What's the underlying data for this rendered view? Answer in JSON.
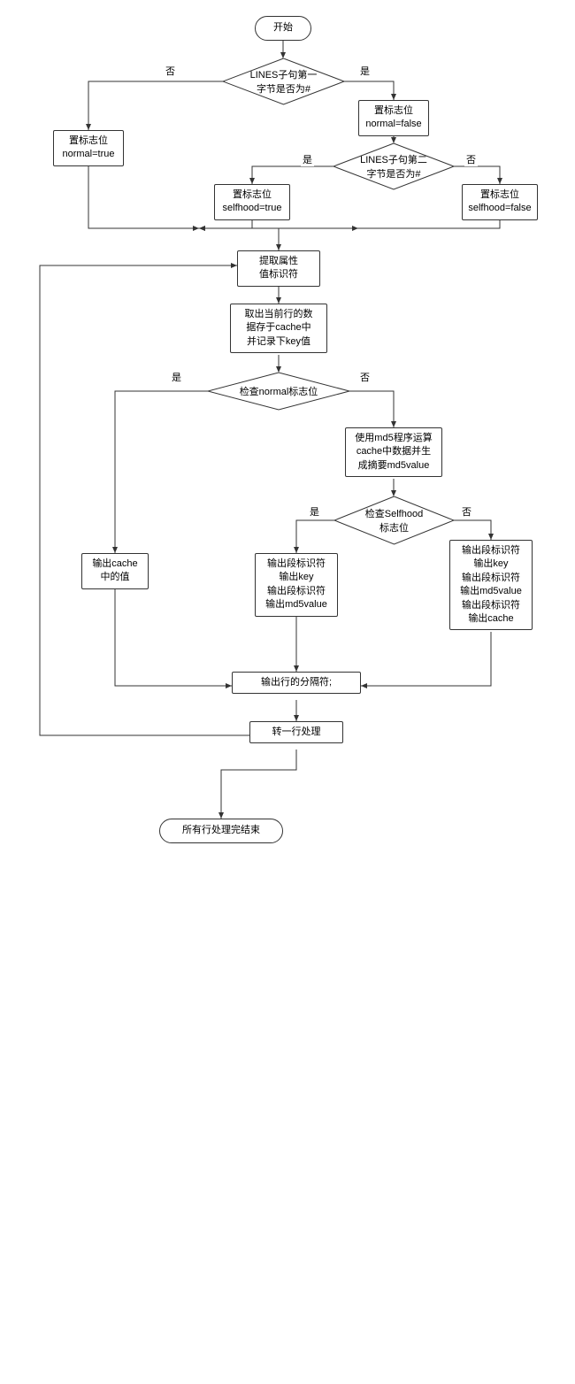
{
  "chart_data": {
    "type": "flowchart",
    "nodes": [
      {
        "id": "start",
        "type": "terminator",
        "text": "开始"
      },
      {
        "id": "d1",
        "type": "decision",
        "text": "LINES子句第一字节是否为#"
      },
      {
        "id": "p_normal_true",
        "type": "process",
        "text": "置标志位\nnormal=true"
      },
      {
        "id": "p_normal_false",
        "type": "process",
        "text": "置标志位\nnormal=false"
      },
      {
        "id": "d2",
        "type": "decision",
        "text": "LINES子句第二字节是否为#"
      },
      {
        "id": "p_self_true",
        "type": "process",
        "text": "置标志位\nselfhood=true"
      },
      {
        "id": "p_self_false",
        "type": "process",
        "text": "置标志位\nselfhood=false"
      },
      {
        "id": "p_extract",
        "type": "process",
        "text": "提取属性\n值标识符"
      },
      {
        "id": "p_cache",
        "type": "process",
        "text": "取出当前行的数\n据存于cache中\n并记录下key值"
      },
      {
        "id": "d3",
        "type": "decision",
        "text": "检查normal标志位"
      },
      {
        "id": "p_md5",
        "type": "process",
        "text": "使用md5程序运算\ncache中数据并生\n成摘要md5value"
      },
      {
        "id": "d4",
        "type": "decision",
        "text": "检查Selfhood\n标志位"
      },
      {
        "id": "p_out_cache",
        "type": "process",
        "text": "输出cache\n中的值"
      },
      {
        "id": "p_out_a",
        "type": "process",
        "text": "输出段标识符\n输出key\n输出段标识符\n输出md5value"
      },
      {
        "id": "p_out_b",
        "type": "process",
        "text": "输出段标识符\n输出key\n输出段标识符\n输出md5value\n输出段标识符\n输出cache"
      },
      {
        "id": "p_sep",
        "type": "process",
        "text": "输出行的分隔符;"
      },
      {
        "id": "p_next",
        "type": "process",
        "text": "转一行处理"
      },
      {
        "id": "end",
        "type": "terminator",
        "text": "所有行处理完结束"
      }
    ],
    "edges": [
      {
        "from": "start",
        "to": "d1"
      },
      {
        "from": "d1",
        "to": "p_normal_true",
        "label": "否"
      },
      {
        "from": "d1",
        "to": "p_normal_false",
        "label": "是"
      },
      {
        "from": "p_normal_false",
        "to": "d2"
      },
      {
        "from": "d2",
        "to": "p_self_true",
        "label": "是"
      },
      {
        "from": "d2",
        "to": "p_self_false",
        "label": "否"
      },
      {
        "from": "p_normal_true",
        "to": "p_extract"
      },
      {
        "from": "p_self_true",
        "to": "p_extract"
      },
      {
        "from": "p_self_false",
        "to": "p_extract"
      },
      {
        "from": "p_extract",
        "to": "p_cache"
      },
      {
        "from": "p_cache",
        "to": "d3"
      },
      {
        "from": "d3",
        "to": "p_out_cache",
        "label": "是"
      },
      {
        "from": "d3",
        "to": "p_md5",
        "label": "否"
      },
      {
        "from": "p_md5",
        "to": "d4"
      },
      {
        "from": "d4",
        "to": "p_out_a",
        "label": "是"
      },
      {
        "from": "d4",
        "to": "p_out_b",
        "label": "否"
      },
      {
        "from": "p_out_cache",
        "to": "p_sep"
      },
      {
        "from": "p_out_a",
        "to": "p_sep"
      },
      {
        "from": "p_out_b",
        "to": "p_sep"
      },
      {
        "from": "p_sep",
        "to": "p_next"
      },
      {
        "from": "p_next",
        "to": "end"
      },
      {
        "from": "p_next",
        "to": "p_extract",
        "label": "loop"
      }
    ],
    "edge_labels": {
      "yes": "是",
      "no": "否"
    }
  },
  "nodes": {
    "start": "开始",
    "d1": "LINES子句第一<br>字节是否为#",
    "p_normal_true": "置标志位<br>normal=true",
    "p_normal_false": "置标志位<br>normal=false",
    "d2": "LINES子句第二<br>字节是否为#",
    "p_self_true": "置标志位<br>selfhood=true",
    "p_self_false": "置标志位<br>selfhood=false",
    "p_extract": "提取属性<br>值标识符",
    "p_cache": "取出当前行的数<br>据存于cache中<br>并记录下key值",
    "d3": "检查normal标志位",
    "p_md5": "使用md5程序运算<br>cache中数据并生<br>成摘要md5value",
    "d4": "检查Selfhood<br>标志位",
    "p_out_cache": "输出cache<br>中的值",
    "p_out_a": "输出段标识符<br>输出key<br>输出段标识符<br>输出md5value",
    "p_out_b": "输出段标识符<br>输出key<br>输出段标识符<br>输出md5value<br>输出段标识符<br>输出cache",
    "p_sep": "输出行的分隔符;",
    "p_next": "转一行处理",
    "end": "所有行处理完结束"
  },
  "labels": {
    "yes": "是",
    "no": "否"
  }
}
